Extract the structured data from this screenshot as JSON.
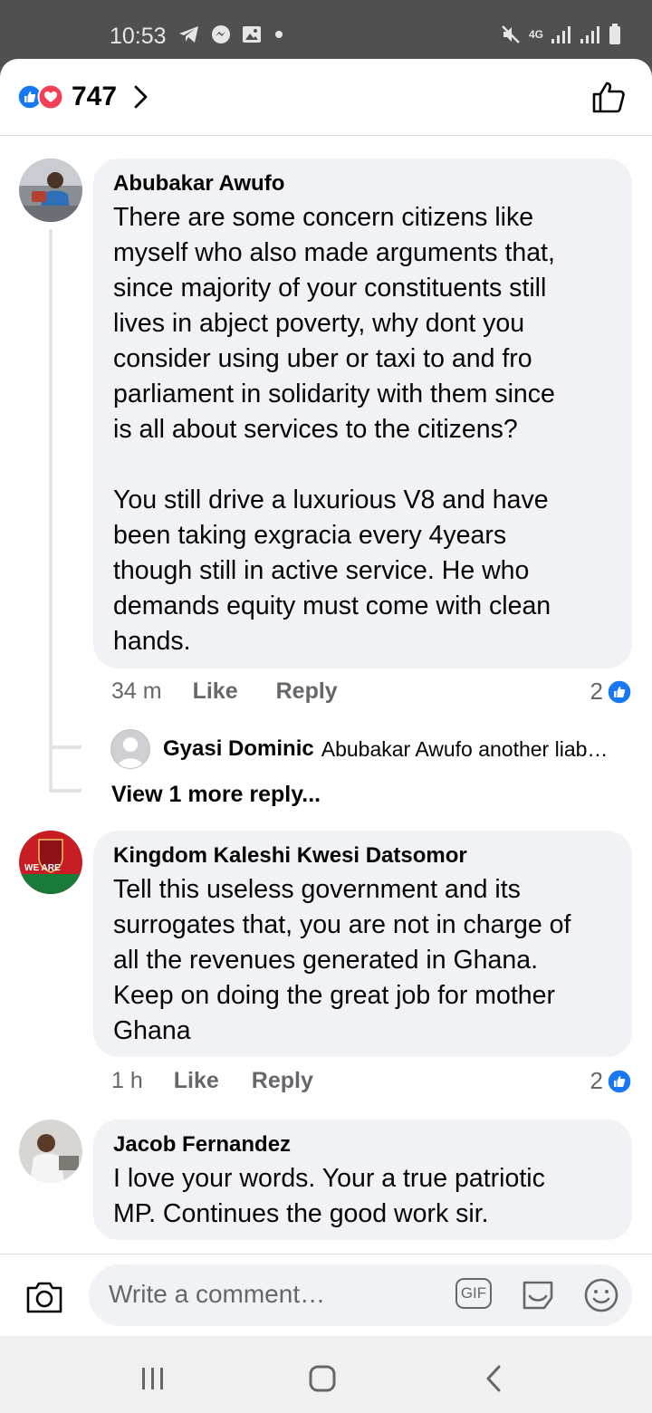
{
  "status_bar": {
    "time": "10:53",
    "network": "4G",
    "icons": [
      "telegram-icon",
      "messenger-icon",
      "gallery-icon",
      "dot-icon",
      "mute-icon",
      "signal-icon",
      "signal-icon",
      "battery-icon"
    ]
  },
  "header": {
    "reaction_count": "747",
    "reactions": [
      "like-icon",
      "love-icon"
    ]
  },
  "comments": [
    {
      "author": "Abubakar Awufo",
      "text": "There are some concern citizens like\nmyself who also made arguments that,\nsince majority of your constituents still\nlives in abject poverty, why dont you\nconsider using uber or taxi to and fro\nparliament in solidarity with them since\nis all about services to the citizens?\n\nYou still drive a luxurious V8 and have\nbeen taking exgracia every 4years\nthough still in active service. He who\ndemands equity must come with clean\nhands.",
      "time": "34 m",
      "like_label": "Like",
      "reply_label": "Reply",
      "likes": "2",
      "replies_preview": {
        "author": "Gyasi Dominic",
        "text": "Abubakar Awufo another liab…",
        "view_more": "View 1 more reply..."
      }
    },
    {
      "author": "Kingdom Kaleshi Kwesi Datsomor",
      "text": "Tell this useless government and its\nsurrogates that, you are not in charge of\nall the revenues generated in Ghana.\nKeep on doing the great job for mother\nGhana",
      "time": "1 h",
      "like_label": "Like",
      "reply_label": "Reply",
      "likes": "2",
      "avatar_text": "WE ARE"
    },
    {
      "author": "Jacob Fernandez",
      "text": "I love your words. Your a true patriotic\nMP. Continues the good work sir."
    }
  ],
  "composer": {
    "placeholder": "Write a comment…",
    "gif_label": "GIF"
  },
  "colors": {
    "accent": "#1877f2",
    "love": "#f33e58",
    "bubble": "#f0f2f5",
    "secondary_text": "#65676b"
  }
}
